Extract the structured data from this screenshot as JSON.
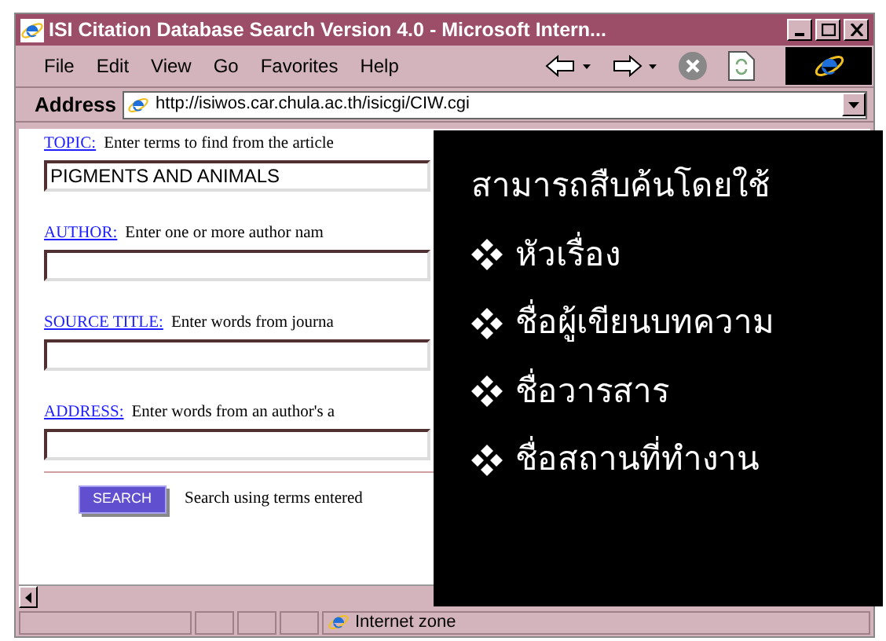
{
  "window": {
    "title": "ISI Citation Database Search Version 4.0 - Microsoft Intern..."
  },
  "menu": [
    "File",
    "Edit",
    "View",
    "Go",
    "Favorites",
    "Help"
  ],
  "address": {
    "label": "Address",
    "value": "http://isiwos.car.chula.ac.th/isicgi/CIW.cgi"
  },
  "fields": [
    {
      "label": "TOPIC:",
      "hint": "Enter terms to find from the article",
      "value": "PIGMENTS AND ANIMALS"
    },
    {
      "label": "AUTHOR:",
      "hint": "Enter one or more author nam"
    },
    {
      "label": "SOURCE TITLE:",
      "hint": "Enter words from journa"
    },
    {
      "label": "ADDRESS:",
      "hint": "Enter words from an author's a"
    }
  ],
  "search": {
    "button": "SEARCH",
    "text": "Search using terms entered"
  },
  "status_bar": {
    "zone": "Internet zone"
  },
  "overlay": {
    "heading": "สามารถสืบค้นโดยใช้",
    "items": [
      "หัวเรื่อง",
      "ชื่อผู้เขียนบทความ",
      "ชื่อวารสาร",
      "ชื่อสถานที่ทำงาน"
    ]
  }
}
